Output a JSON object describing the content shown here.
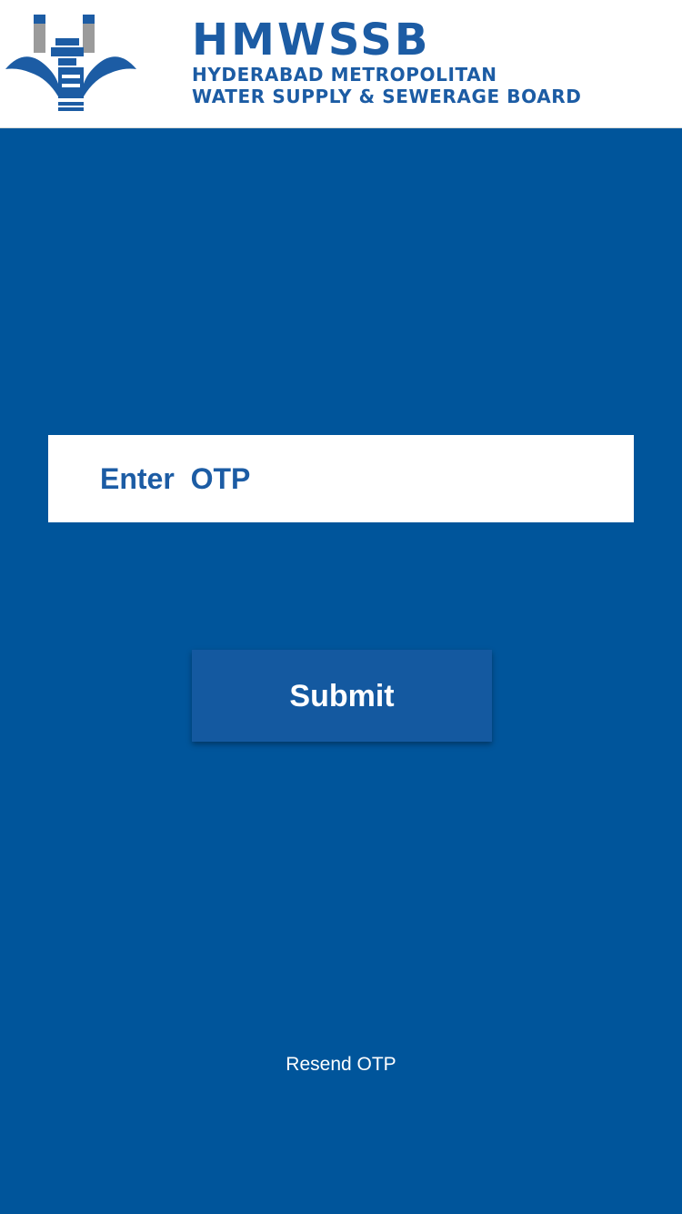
{
  "header": {
    "logo_icon": "hmwssb-logo-icon",
    "title": "HMWSSB",
    "subtitle_line1": "HYDERABAD METROPOLITAN",
    "subtitle_line2": "WATER SUPPLY & SEWERAGE BOARD"
  },
  "form": {
    "otp_placeholder": "Enter  OTP",
    "otp_value": "",
    "submit_label": "Submit",
    "resend_label": "Resend OTP"
  },
  "colors": {
    "background": "#00559b",
    "brand": "#1c5ca4",
    "button": "#1459a0",
    "white": "#ffffff"
  }
}
